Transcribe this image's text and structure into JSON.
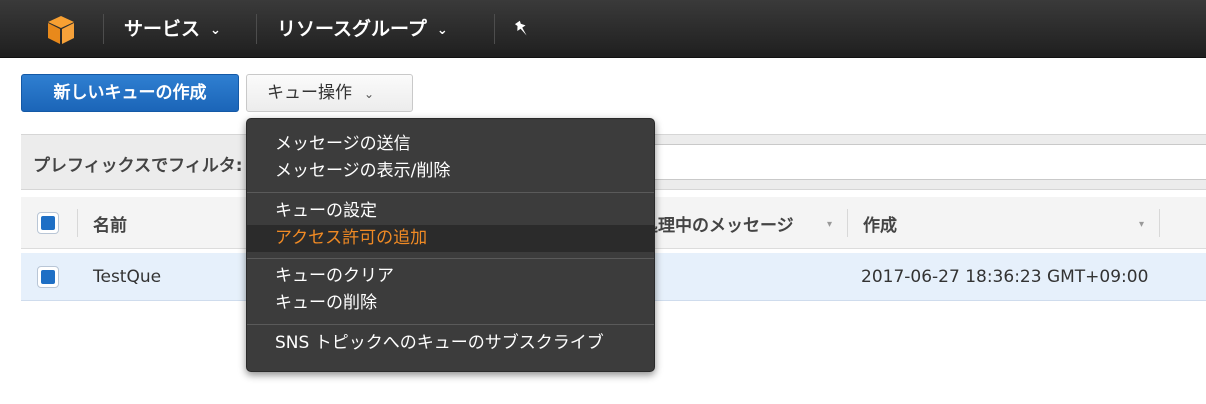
{
  "nav": {
    "services_label": "サービス",
    "resource_groups_label": "リソースグループ",
    "chevron": "⌄"
  },
  "toolbar": {
    "create_queue_label": "新しいキューの作成",
    "queue_actions_label": "キュー操作",
    "chevron": "⌄"
  },
  "filter": {
    "label": "プレフィックスでフィルタ:",
    "placeholder": ""
  },
  "table": {
    "columns": [
      {
        "label": "名前"
      },
      {
        "label": "処理中のメッセージ"
      },
      {
        "label": "作成"
      }
    ],
    "sort_arrow": "▾",
    "rows": [
      {
        "name": "TestQue",
        "created": "2017-06-27 18:36:23 GMT+09:00"
      }
    ]
  },
  "menu": {
    "items": [
      {
        "label": "メッセージの送信"
      },
      {
        "label": "メッセージの表示/削除"
      },
      {
        "label": "キューの設定"
      },
      {
        "label": "アクセス許可の追加"
      },
      {
        "label": "キューのクリア"
      },
      {
        "label": "キューの削除"
      },
      {
        "label": "SNS トピックへのキューのサブスクライブ"
      }
    ],
    "highlighted_index": 3
  },
  "colors": {
    "topbar": "#2b2b2b",
    "primary": "#1b65b8",
    "menu_bg": "#3c3c3c",
    "menu_highlight_text": "#f08a24",
    "row_selected": "#e6f0fb"
  },
  "icons": [
    "aws-cube-icon",
    "pin-icon",
    "chevron-down-icon",
    "checkbox-icon",
    "sort-arrow-icon"
  ]
}
